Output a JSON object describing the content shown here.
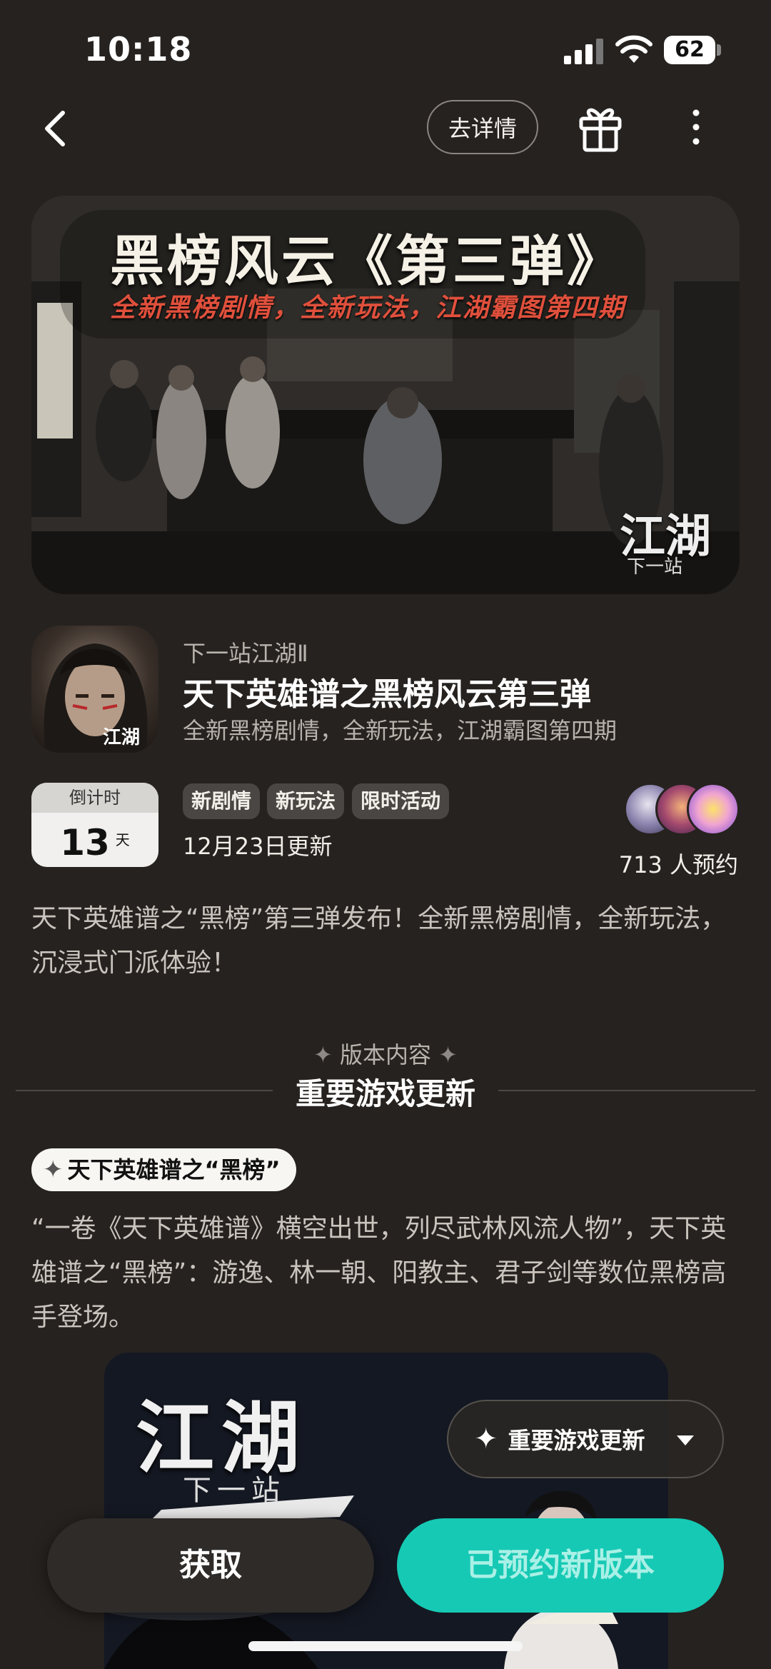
{
  "status_bar": {
    "time": "10:18",
    "battery": "62"
  },
  "header": {
    "detail_button": "去详情"
  },
  "banner": {
    "title": "黑榜风云《第三弹》",
    "subtitle": "全新黑榜剧情，全新玩法，江湖霸图第四期",
    "logo": "江湖",
    "logo_sub": "下一站"
  },
  "app": {
    "name": "下一站江湖Ⅱ",
    "event_title": "天下英雄谱之黑榜风云第三弹",
    "event_desc": "全新黑榜剧情，全新玩法，江湖霸图第四期"
  },
  "countdown": {
    "label": "倒计时",
    "value": "13",
    "unit": "天"
  },
  "tags": [
    "新剧情",
    "新玩法",
    "限时活动"
  ],
  "update_date": "12月23日更新",
  "reservations": {
    "text": "713 人预约"
  },
  "intro": "天下英雄谱之“黑榜”第三弹发布！全新黑榜剧情，全新玩法，沉浸式门派体验！",
  "section": {
    "label": "版本内容",
    "title": "重要游戏更新"
  },
  "topic": {
    "pill": "天下英雄谱之“黑榜”",
    "text": "“一卷《天下英雄谱》横空出世，列尽武林风流人物”，天下英雄谱之“黑榜”：游逸、林一朝、阳教主、君子剑等数位黑榜高手登场。"
  },
  "content_image": {
    "logo": "江湖",
    "logo_sub": "下一站"
  },
  "float_dropdown": {
    "label": "重要游戏更新"
  },
  "buttons": {
    "get": "获取",
    "reserved": "已预约新版本"
  },
  "colors": {
    "background": "#26221f",
    "accent": "#16c9b4"
  }
}
